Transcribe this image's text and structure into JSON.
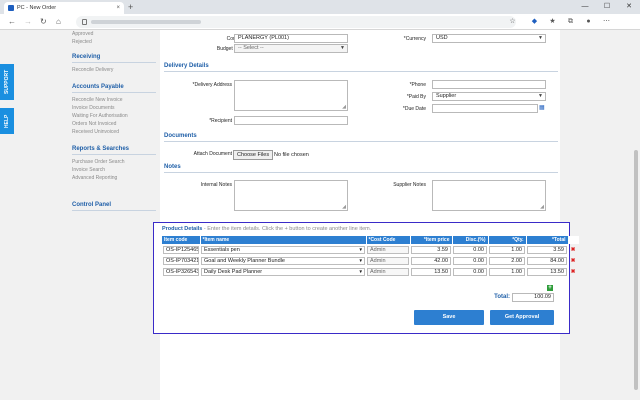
{
  "browser": {
    "tab_title": "PC - New Order",
    "tab_close": "×",
    "new_tab": "+",
    "win_min": "—",
    "win_max": "☐",
    "win_close": "✕"
  },
  "side_tabs": [
    "SUPPORT",
    "HELP"
  ],
  "leftnav": {
    "top_links": [
      "Approved",
      "Rejected"
    ],
    "sections": [
      {
        "heading": "Receiving",
        "links": [
          "Reconcile Delivery"
        ]
      },
      {
        "heading": "Accounts Payable",
        "links": [
          "Reconcile New Invoice",
          "Invoice Documents",
          "Waiting For Authorisation",
          "Orders Not Invoiced",
          "Received Uninvoiced"
        ]
      },
      {
        "heading": "Reports & Searches",
        "links": [
          "Purchase Order Search",
          "Invoice Search",
          "Advanced Reporting"
        ]
      },
      {
        "heading": "Control Panel",
        "links": []
      }
    ]
  },
  "form": {
    "company_label": "Company",
    "company_value": "PLANERGY (PL001)",
    "budget_label": "Budget Month",
    "budget_value": "-- Select --",
    "currency_label": "*Currency",
    "currency_value": "USD",
    "delivery_section": "Delivery Details",
    "delivery_address_label": "*Delivery Address",
    "recipient_label": "*Recipient",
    "phone_label": "*Phone",
    "paid_by_label": "*Paid By",
    "paid_by_value": "Supplier",
    "due_date_label": "*Due Date",
    "documents_section": "Documents",
    "attach_label": "Attach Document",
    "choose_files": "Choose Files",
    "no_file": "No file chosen",
    "notes_section": "Notes",
    "internal_notes_label": "Internal Notes",
    "supplier_notes_label": "Supplier Notes"
  },
  "products": {
    "title_bold": "Product Details",
    "title_hint": " - Enter the item details. Click the + button to create another line item.",
    "columns": [
      "Item code",
      "*Item name",
      "*Cost Code",
      "*Item price",
      "Disc.(%)",
      "*Qty.",
      "*Total"
    ],
    "rows": [
      {
        "code": "OS-IP125465",
        "name": "Essentials pen",
        "cost_code": "Admin",
        "price": "3.59",
        "disc": "0.00",
        "qty": "1.00",
        "total": "3.59"
      },
      {
        "code": "OS-IP703421",
        "name": "Goal and Weekly Planner Bundle",
        "cost_code": "Admin",
        "price": "42.00",
        "disc": "0.00",
        "qty": "2.00",
        "total": "84.00"
      },
      {
        "code": "OS-IP326543",
        "name": "Daily Desk Pad Planner",
        "cost_code": "Admin",
        "price": "13.50",
        "disc": "0.00",
        "qty": "1.00",
        "total": "13.50"
      }
    ],
    "total_label": "Total:",
    "total_value": "100.09",
    "save_button": "Save",
    "approval_button": "Get Approval"
  }
}
